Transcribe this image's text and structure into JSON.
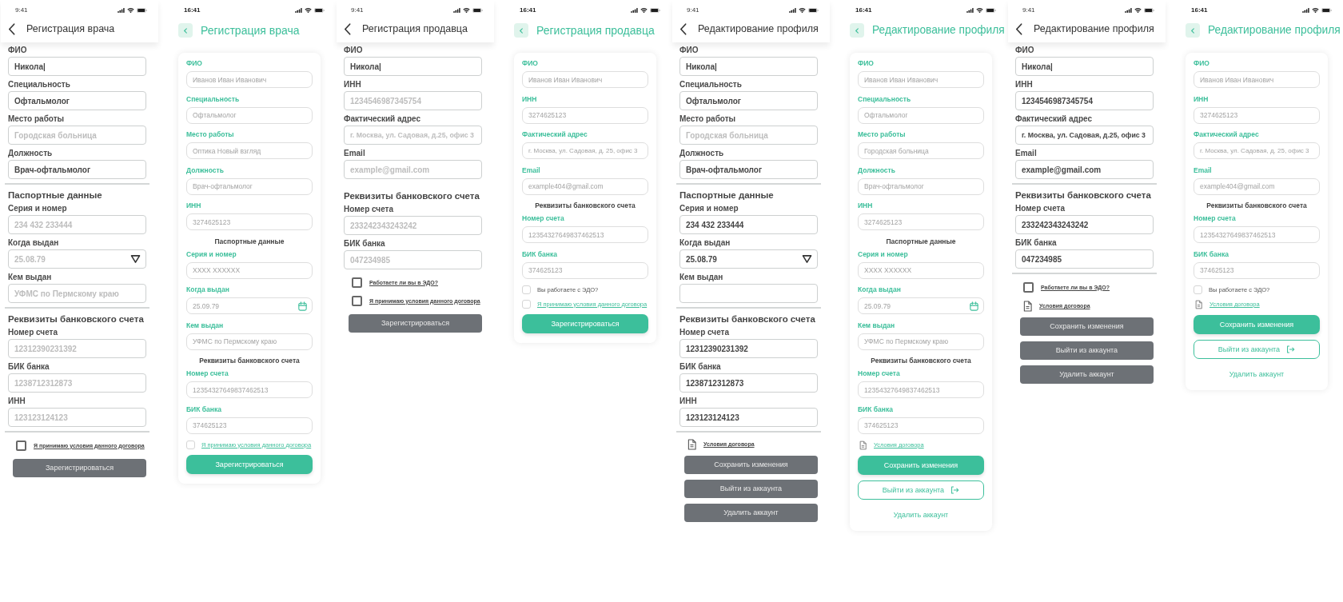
{
  "screens": [
    {
      "kind": "wireframe",
      "status_bar": {
        "time": "9:41"
      },
      "header": {
        "title": "Регистрация врача"
      },
      "items": [
        {
          "kind": "field",
          "label": "ФИО",
          "value": "Никола|"
        },
        {
          "kind": "field",
          "label": "Специальность",
          "value": "Офтальмолог"
        },
        {
          "kind": "field",
          "label": "Место работы",
          "placeholder": "Городская больница"
        },
        {
          "kind": "field",
          "label": "Должность",
          "value": "Врач-офтальмолог"
        },
        {
          "kind": "divider"
        },
        {
          "kind": "heading",
          "text": "Паспортные данные"
        },
        {
          "kind": "field",
          "label": "Серия и номер",
          "placeholder": "234 432 233444"
        },
        {
          "kind": "date_field",
          "label": "Когда выдан",
          "placeholder": "25.08.79"
        },
        {
          "kind": "field",
          "label": "Кем выдан",
          "placeholder": "УФМС по Пермскому краю"
        },
        {
          "kind": "divider"
        },
        {
          "kind": "heading",
          "text": "Реквизиты банковского счета"
        },
        {
          "kind": "field",
          "label": "Номер счета",
          "placeholder": "12312390231392"
        },
        {
          "kind": "field",
          "label": "БИК банка",
          "placeholder": "1238712312873"
        },
        {
          "kind": "field",
          "label": "ИНН",
          "placeholder": "123123124123"
        },
        {
          "kind": "divider"
        },
        {
          "kind": "checkbox",
          "label": "Я принимаю условия данного договора",
          "checked": false,
          "link": true
        },
        {
          "kind": "button",
          "label": "Зарегистрироваться"
        }
      ]
    },
    {
      "kind": "styled",
      "status_bar": {
        "time": "16:41"
      },
      "header": {
        "title": "Регистрация врача"
      },
      "items": [
        {
          "kind": "field",
          "label": "ФИО",
          "placeholder": "Иванов Иван Иванович"
        },
        {
          "kind": "field",
          "label": "Специальность",
          "placeholder": "Офтальмолог"
        },
        {
          "kind": "field",
          "label": "Место работы",
          "placeholder": "Оптика Новый взгляд"
        },
        {
          "kind": "field",
          "label": "Должность",
          "placeholder": "Врач-офтальмолог"
        },
        {
          "kind": "field",
          "label": "ИНН",
          "placeholder": "3274625123"
        },
        {
          "kind": "heading",
          "text": "Паспортные данные"
        },
        {
          "kind": "field",
          "label": "Серия и номер",
          "placeholder": "XXXX XXXXXX"
        },
        {
          "kind": "date_field",
          "label": "Когда выдан",
          "placeholder": "25.09.79"
        },
        {
          "kind": "field",
          "label": "Кем выдан",
          "placeholder": "УФМС по Пермскому краю"
        },
        {
          "kind": "heading",
          "text": "Реквизиты банковского счета"
        },
        {
          "kind": "field",
          "label": "Номер счета",
          "placeholder": "12354327649837462513"
        },
        {
          "kind": "field",
          "label": "БИК банка",
          "placeholder": "374625123"
        },
        {
          "kind": "checkbox",
          "label": "Я принимаю условия данного договора",
          "checked": false,
          "link": true
        },
        {
          "kind": "primary_button",
          "label": "Зарегистрироваться"
        }
      ]
    },
    {
      "kind": "wireframe",
      "status_bar": {
        "time": "9:41"
      },
      "header": {
        "title": "Регистрация продавца"
      },
      "items": [
        {
          "kind": "field",
          "label": "ФИО",
          "value": "Никола|"
        },
        {
          "kind": "field",
          "label": "ИНН",
          "placeholder": "1234546987345754"
        },
        {
          "kind": "field",
          "label": "Фактический адрес",
          "placeholder": "г. Москва, ул. Садовая, д.25, офис 3"
        },
        {
          "kind": "field",
          "label": "Email",
          "placeholder": "example@gmail.com"
        },
        {
          "kind": "heading",
          "text": "Реквизиты банковского счета"
        },
        {
          "kind": "field",
          "label": "Номер счета",
          "placeholder": "233242343243242"
        },
        {
          "kind": "field",
          "label": "БИК банка",
          "placeholder": "047234985"
        },
        {
          "kind": "checkbox",
          "label": "Работаете ли вы в ЭДО?",
          "checked": false,
          "link": true
        },
        {
          "kind": "checkbox",
          "label": "Я принимаю условия данного договора",
          "checked": false,
          "link": true
        },
        {
          "kind": "button",
          "label": "Зарегистрироваться"
        }
      ]
    },
    {
      "kind": "styled",
      "status_bar": {
        "time": "16:41"
      },
      "header": {
        "title": "Регистрация продавца"
      },
      "items": [
        {
          "kind": "field",
          "label": "ФИО",
          "placeholder": "Иванов Иван Иванович"
        },
        {
          "kind": "field",
          "label": "ИНН",
          "placeholder": "3274625123"
        },
        {
          "kind": "field",
          "label": "Фактический адрес",
          "placeholder": "г. Москва, ул. Садовая, д. 25, офис 3"
        },
        {
          "kind": "field",
          "label": "Email",
          "placeholder": "example404@gmail.com"
        },
        {
          "kind": "heading",
          "text": "Реквизиты банковского счета"
        },
        {
          "kind": "field",
          "label": "Номер счета",
          "placeholder": "12354327649837462513"
        },
        {
          "kind": "field",
          "label": "БИК банка",
          "placeholder": "374625123"
        },
        {
          "kind": "checkbox",
          "label": "Вы работаете с ЭДО?",
          "checked": false,
          "link": false
        },
        {
          "kind": "checkbox",
          "label": "Я принимаю условия данного договора",
          "checked": false,
          "link": true
        },
        {
          "kind": "primary_button",
          "label": "Зарегистрироваться"
        }
      ]
    },
    {
      "kind": "wireframe",
      "status_bar": {
        "time": "9:41"
      },
      "header": {
        "title": "Редактирование профиля"
      },
      "items": [
        {
          "kind": "field",
          "label": "ФИО",
          "value": "Никола|"
        },
        {
          "kind": "field",
          "label": "Специальность",
          "value": "Офтальмолог"
        },
        {
          "kind": "field",
          "label": "Место работы",
          "placeholder": "Городская больница"
        },
        {
          "kind": "field",
          "label": "Должность",
          "value": "Врач-офтальмолог"
        },
        {
          "kind": "divider"
        },
        {
          "kind": "heading",
          "text": "Паспортные данные"
        },
        {
          "kind": "field",
          "label": "Серия и номер",
          "value": "234 432 233444"
        },
        {
          "kind": "date_field",
          "label": "Когда выдан",
          "value": "25.08.79"
        },
        {
          "kind": "field",
          "label": "Кем выдан"
        },
        {
          "kind": "divider"
        },
        {
          "kind": "heading",
          "text": "Реквизиты банковского счета"
        },
        {
          "kind": "field",
          "label": "Номер счета",
          "value": "12312390231392"
        },
        {
          "kind": "field",
          "label": "БИК банка",
          "value": "1238712312873"
        },
        {
          "kind": "field",
          "label": "ИНН",
          "value": "123123124123"
        },
        {
          "kind": "divider"
        },
        {
          "kind": "document",
          "label": "Условия договора"
        },
        {
          "kind": "button",
          "label": "Сохранить изменения"
        },
        {
          "kind": "button",
          "label": "Выйти из аккаунта"
        },
        {
          "kind": "button",
          "label": "Удалить аккаунт"
        }
      ]
    },
    {
      "kind": "styled",
      "status_bar": {
        "time": "16:41"
      },
      "header": {
        "title": "Редактирование профиля"
      },
      "items": [
        {
          "kind": "field",
          "label": "ФИО",
          "placeholder": "Иванов Иван Иванович"
        },
        {
          "kind": "field",
          "label": "Специальность",
          "placeholder": "Офтальмолог"
        },
        {
          "kind": "field",
          "label": "Место работы",
          "placeholder": "Городская больница"
        },
        {
          "kind": "field",
          "label": "Должность",
          "placeholder": "Врач-офтальмолог"
        },
        {
          "kind": "field",
          "label": "ИНН",
          "placeholder": "3274625123"
        },
        {
          "kind": "heading",
          "text": "Паспортные данные"
        },
        {
          "kind": "field",
          "label": "Серия и номер",
          "placeholder": "XXXX XXXXXX"
        },
        {
          "kind": "date_field",
          "label": "Когда выдан",
          "placeholder": "25.09.79"
        },
        {
          "kind": "field",
          "label": "Кем выдан",
          "placeholder": "УФМС по Пермскому краю"
        },
        {
          "kind": "heading",
          "text": "Реквизиты банковского счета"
        },
        {
          "kind": "field",
          "label": "Номер счета",
          "placeholder": "12354327649837462513"
        },
        {
          "kind": "field",
          "label": "БИК банка",
          "placeholder": "374625123"
        },
        {
          "kind": "document",
          "label": "Условия договора"
        },
        {
          "kind": "primary_button",
          "label": "Сохранить изменения"
        },
        {
          "kind": "outline_button",
          "label": "Выйти из аккаунта"
        },
        {
          "kind": "link_button",
          "label": "Удалить аккаунт"
        }
      ]
    },
    {
      "kind": "wireframe",
      "status_bar": {
        "time": "9:41"
      },
      "header": {
        "title": "Редактирование профиля"
      },
      "items": [
        {
          "kind": "field",
          "label": "ФИО",
          "value": "Никола|"
        },
        {
          "kind": "field",
          "label": "ИНН",
          "value": "1234546987345754"
        },
        {
          "kind": "field",
          "label": "Фактический адрес",
          "value": "г. Москва, ул. Садовая, д.25, офис 3"
        },
        {
          "kind": "field",
          "label": "Email",
          "value": "example@gmail.com"
        },
        {
          "kind": "divider"
        },
        {
          "kind": "heading",
          "text": "Реквизиты банковского счета"
        },
        {
          "kind": "field",
          "label": "Номер счета",
          "value": "233242343243242"
        },
        {
          "kind": "field",
          "label": "БИК банка",
          "value": "047234985"
        },
        {
          "kind": "divider"
        },
        {
          "kind": "checkbox",
          "label": "Работаете ли вы в ЭДО?",
          "checked": false,
          "link": true
        },
        {
          "kind": "document",
          "label": "Условия договора"
        },
        {
          "kind": "button",
          "label": "Сохранить изменения"
        },
        {
          "kind": "button",
          "label": "Выйти из аккаунта"
        },
        {
          "kind": "button",
          "label": "Удалить аккаунт"
        }
      ]
    },
    {
      "kind": "styled",
      "status_bar": {
        "time": "16:41"
      },
      "header": {
        "title": "Редактирование профиля"
      },
      "items": [
        {
          "kind": "field",
          "label": "ФИО",
          "placeholder": "Иванов Иван Иванович"
        },
        {
          "kind": "field",
          "label": "ИНН",
          "placeholder": "3274625123"
        },
        {
          "kind": "field",
          "label": "Фактический адрес",
          "placeholder": "г. Москва, ул. Садовая, д. 25, офис 3"
        },
        {
          "kind": "field",
          "label": "Email",
          "placeholder": "example404@gmail.com"
        },
        {
          "kind": "heading",
          "text": "Реквизиты банковского счета"
        },
        {
          "kind": "field",
          "label": "Номер счета",
          "placeholder": "12354327649837462513"
        },
        {
          "kind": "field",
          "label": "БИК банка",
          "placeholder": "374625123"
        },
        {
          "kind": "checkbox",
          "label": "Вы работаете с ЭДО?",
          "checked": false,
          "link": false
        },
        {
          "kind": "document",
          "label": "Условия договора"
        },
        {
          "kind": "primary_button",
          "label": "Сохранить изменения"
        },
        {
          "kind": "outline_button",
          "label": "Выйти из аккаунта"
        },
        {
          "kind": "link_button",
          "label": "Удалить аккаунт"
        }
      ]
    }
  ]
}
